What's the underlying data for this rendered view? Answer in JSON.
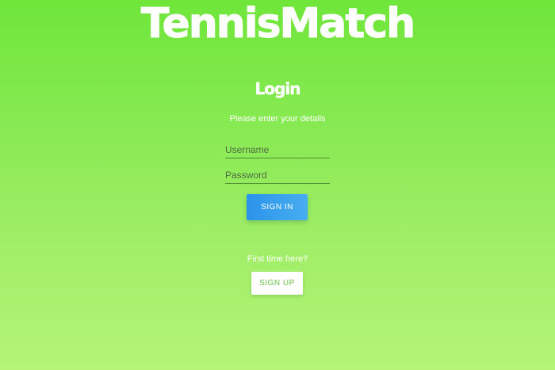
{
  "app": {
    "title": "TennisMatch"
  },
  "login": {
    "heading": "Login",
    "subtitle": "Please enter your details",
    "username_placeholder": "Username",
    "username_value": "",
    "password_placeholder": "Password",
    "password_value": "",
    "sign_in_label": "SIGN IN"
  },
  "signup": {
    "prompt": "First time here?",
    "sign_up_label": "SIGN UP"
  },
  "colors": {
    "background_top": "#6fe63a",
    "background_bottom": "#b5f476",
    "primary_button": "#2b94ea",
    "signup_text": "#6cc04a",
    "text": "#ffffff"
  }
}
